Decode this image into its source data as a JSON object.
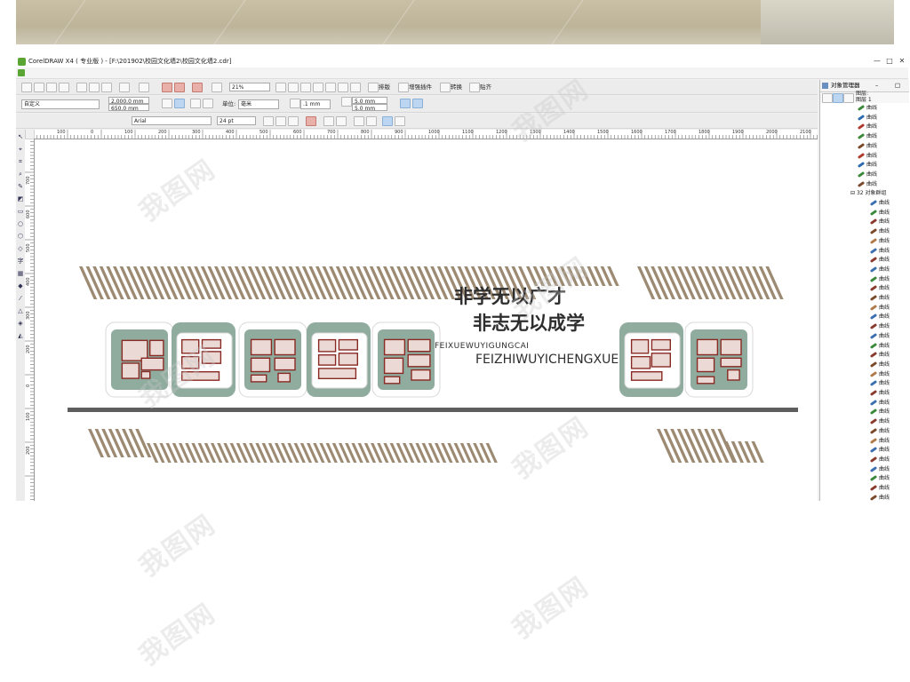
{
  "app": {
    "title": "CorelDRAW X4 ( 专业版 ) - [F:\\201902\\校园文化墙2\\校园文化墙2.cdr]",
    "window_controls": [
      "—",
      "□",
      "✕"
    ]
  },
  "toolbar1": {
    "zoom": "21%",
    "buttons": [
      "排版",
      "增强插件",
      "转换",
      "贴齐"
    ]
  },
  "toolbar2": {
    "paper_preset": "自定义",
    "width": "2,000.0 mm",
    "height": "650.0 mm",
    "unit_label": "单位:",
    "unit_value": "毫米",
    "nudge": ".1 mm",
    "dup_x": "5.0 mm",
    "dup_y": "5.0 mm"
  },
  "toolbar3": {
    "font_name": "Arial",
    "font_size": "24 pt"
  },
  "ruler": {
    "h_labels": [
      "100",
      "0",
      "100",
      "200",
      "300",
      "400",
      "500",
      "600",
      "700",
      "800",
      "900",
      "1000",
      "1100",
      "1200",
      "1300",
      "1400",
      "1500",
      "1600",
      "1700",
      "1800",
      "1900",
      "2000",
      "2100"
    ],
    "v_labels": [
      "700",
      "600",
      "500",
      "400",
      "300",
      "200",
      "0",
      "100",
      "200"
    ]
  },
  "design": {
    "slogan_line1": "非学无以广才",
    "slogan_line2": "非志无以成学",
    "pinyin_line1": "FEIXUEWUYIGUNGCAI",
    "pinyin_line2": "FEIZHIWUYICHENGXUE",
    "colors": {
      "stripe": "#9c8a72",
      "green": "#8fac9f",
      "photo_fill": "#ead9d4",
      "photo_border": "#8a2a24",
      "base_line": "#5e5e5e",
      "text_dark": "#2e2e2e"
    }
  },
  "object_manager": {
    "title": "对象管理器",
    "layer_label": "图层:",
    "layer_name": "图层 1",
    "group_label": "32 对象群组",
    "item_label": "曲线",
    "top_items": 9,
    "group_items": 32
  },
  "watermark": "我图网"
}
